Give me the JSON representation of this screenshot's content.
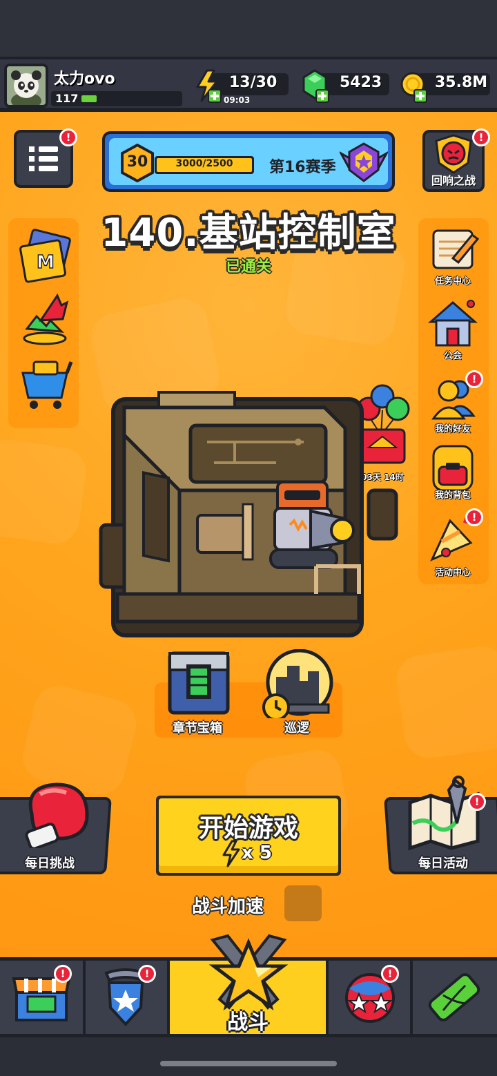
{
  "player": {
    "name": "太力ovo",
    "level": "117"
  },
  "resources": {
    "energy": {
      "value": "13/30",
      "timer": "09:03",
      "icon": "lightning-plus-icon"
    },
    "gems": {
      "value": "5423",
      "icon": "green-gem-plus-icon"
    },
    "coins": {
      "value": "35.8M",
      "icon": "gold-coin-plus-icon"
    }
  },
  "season": {
    "level": "30",
    "progress": "3000/2500",
    "title": "第16赛季"
  },
  "echo_battle": {
    "label": "回响之战"
  },
  "stage": {
    "title": "140.基站控制室",
    "status": "已通关"
  },
  "right_menu": [
    {
      "label": "任务中心",
      "icon": "quest-scroll-icon",
      "badge": false
    },
    {
      "label": "公会",
      "icon": "guild-house-icon",
      "badge": false
    },
    {
      "label": "我的好友",
      "icon": "friends-icon",
      "badge": true
    },
    {
      "label": "我的背包",
      "icon": "backpack-icon",
      "badge": false
    },
    {
      "label": "活动中心",
      "icon": "party-popper-icon",
      "badge": true
    }
  ],
  "left_menu": [
    {
      "icon": "monthly-card-icon"
    },
    {
      "icon": "growth-fund-icon"
    },
    {
      "icon": "shop-cart-icon"
    }
  ],
  "event_timer": "03天 14时",
  "chapter_chest": {
    "label": "章节宝箱"
  },
  "patrol": {
    "label": "巡逻"
  },
  "start_game": {
    "label": "开始游戏",
    "cost": "x 5"
  },
  "daily_challenge": {
    "label": "每日挑战"
  },
  "daily_event": {
    "label": "每日活动"
  },
  "battle_speed": {
    "label": "战斗加速"
  },
  "nav": {
    "tabs": [
      {
        "name": "shop",
        "icon": "shop-stall-icon",
        "badge": true
      },
      {
        "name": "equipment",
        "icon": "shield-star-icon",
        "badge": true
      },
      {
        "name": "battle",
        "label": "战斗",
        "icon": "crossed-swords-star-icon",
        "active": true
      },
      {
        "name": "talents",
        "icon": "stars-orb-icon",
        "badge": true
      },
      {
        "name": "evolve",
        "icon": "dna-capsule-icon",
        "badge": false
      }
    ]
  },
  "colors": {
    "background": "#ffa51d",
    "accent_yellow": "#ffd21e",
    "dark_frame": "#1f2128",
    "badge_red": "#e8233a",
    "status_green": "#9cf03c"
  }
}
